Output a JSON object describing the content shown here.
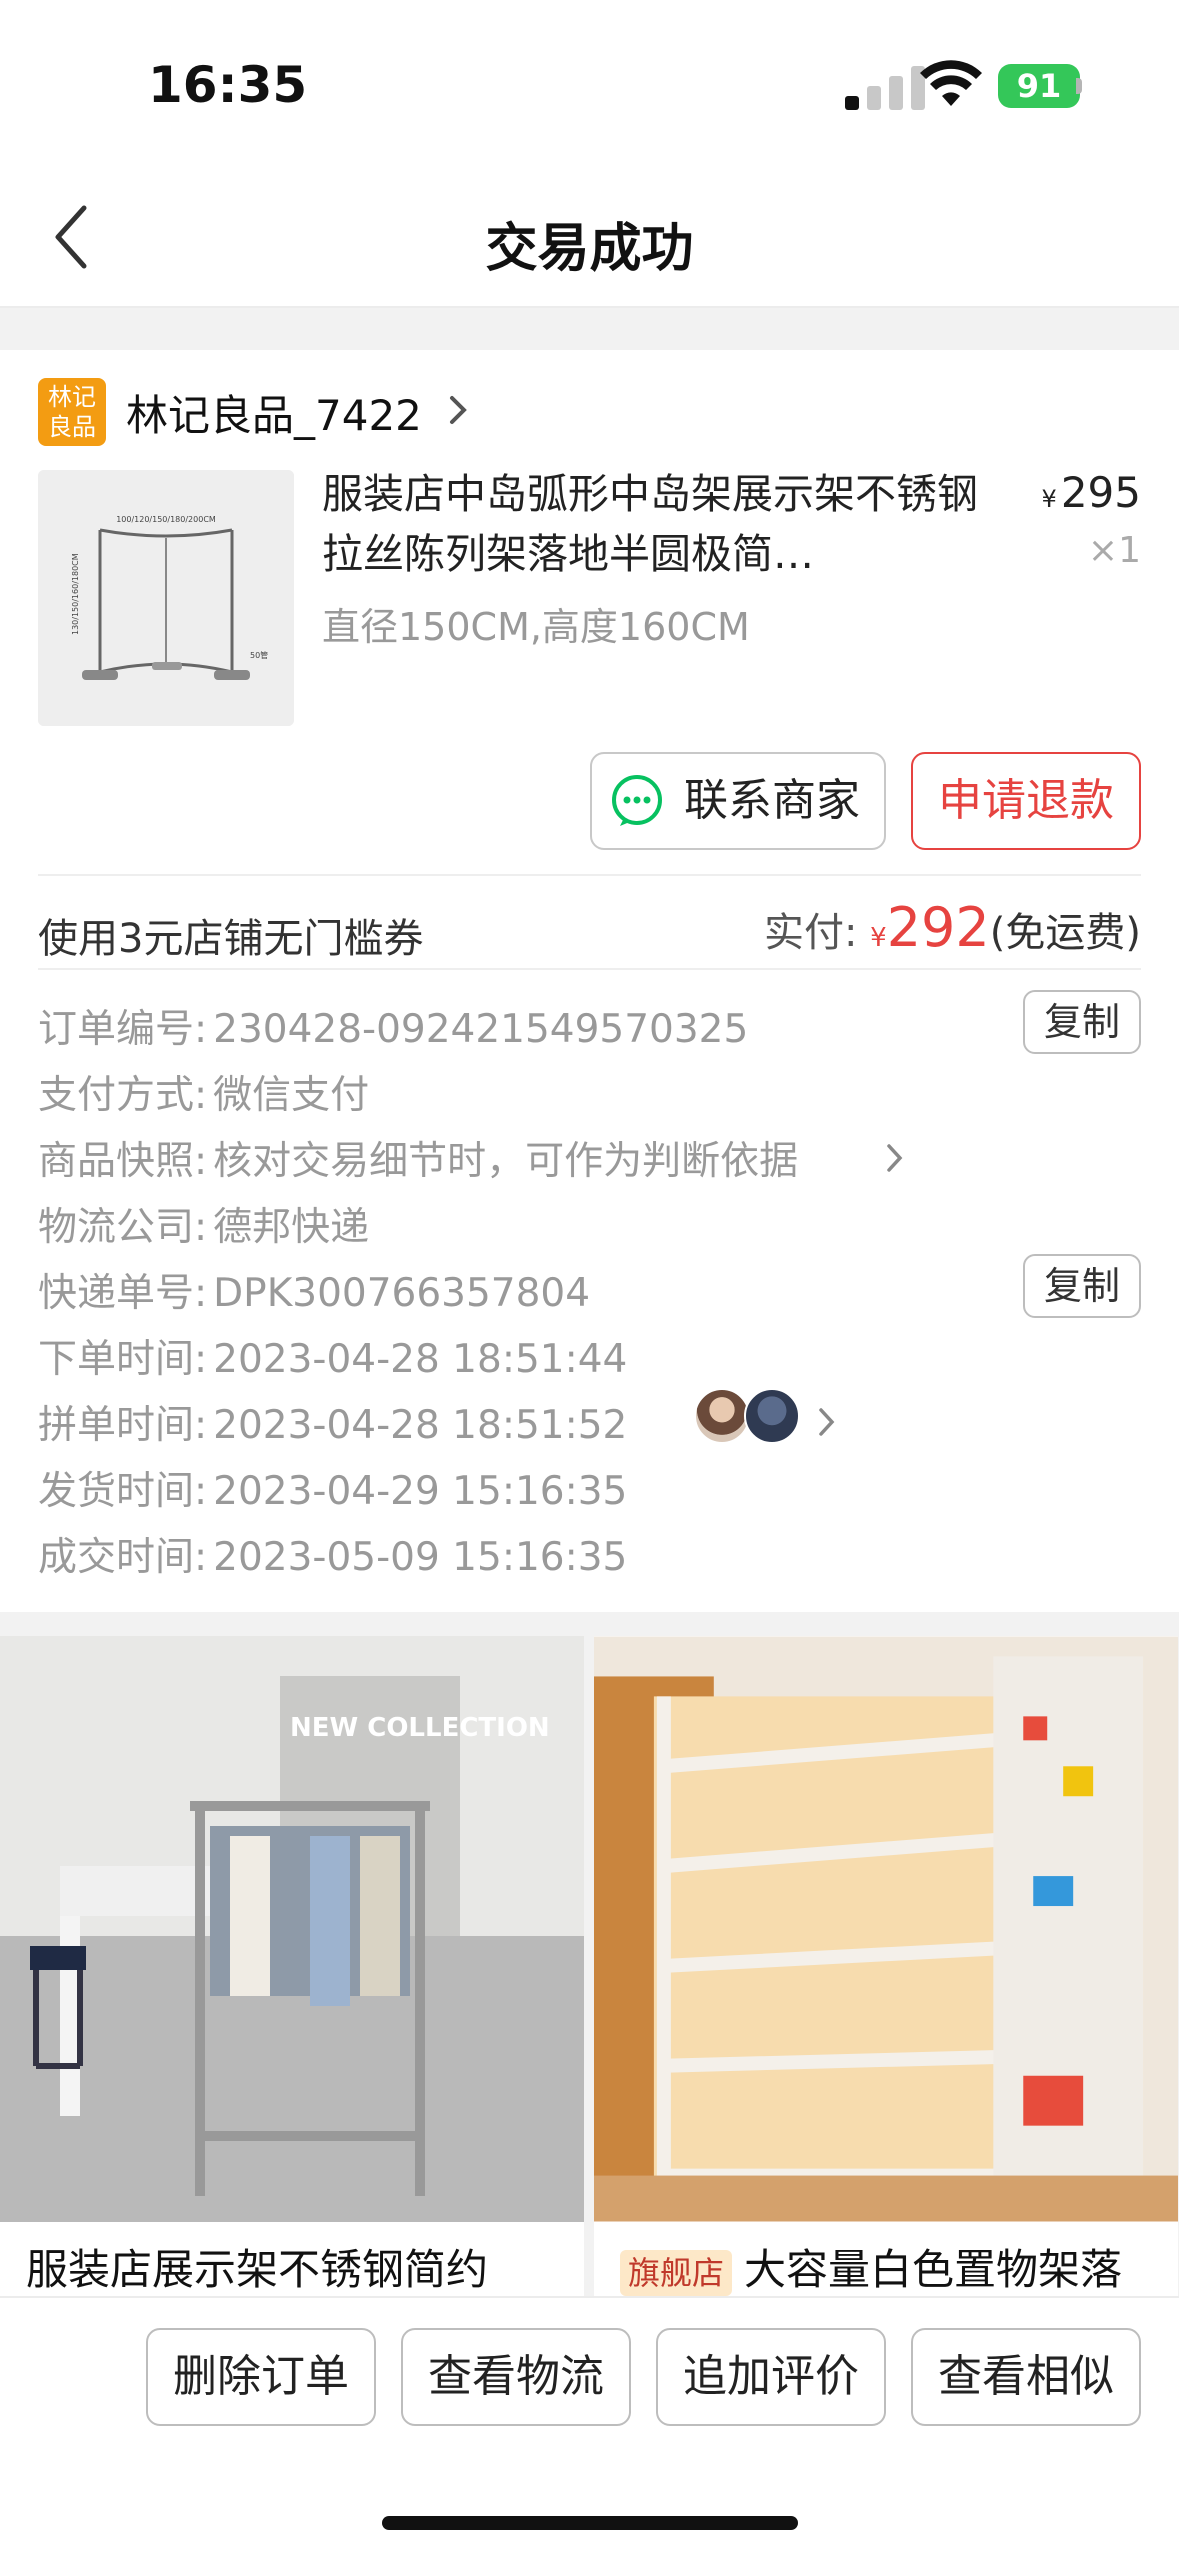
{
  "status": {
    "time": "16:35",
    "battery": "91"
  },
  "nav": {
    "title": "交易成功"
  },
  "shop": {
    "logo_line1": "林记",
    "logo_line2": "良品",
    "name": "林记良品_7422"
  },
  "product": {
    "title": "服装店中岛弧形中岛架展示架不锈钢拉丝陈列架落地半圆极简…",
    "spec": "直径150CM,高度160CM",
    "currency": "¥",
    "price": "295",
    "qty": "×1",
    "diagram_label_top": "100/120/150/180/200CM",
    "diagram_label_side": "130/150/160/180CM",
    "diagram_label_foot": "50管"
  },
  "actions": {
    "contact": "联系商家",
    "refund": "申请退款"
  },
  "payment": {
    "coupon": "使用3元店铺无门槛券",
    "paid_label": "实付:",
    "currency": "¥",
    "paid_amount": "292",
    "shipping": "(免运费)"
  },
  "order_info": [
    {
      "label": "订单编号:",
      "value": "230428-092421549570325"
    },
    {
      "label": "支付方式:",
      "value": "微信支付"
    },
    {
      "label": "商品快照:",
      "value": "核对交易细节时，可作为判断依据"
    },
    {
      "label": "物流公司:",
      "value": "德邦快递"
    },
    {
      "label": "快递单号:",
      "value": "DPK300766357804"
    },
    {
      "label": "下单时间:",
      "value": "2023-04-28 18:51:44"
    },
    {
      "label": "拼单时间:",
      "value": "2023-04-28 18:51:52"
    },
    {
      "label": "发货时间:",
      "value": "2023-04-29 15:16:35"
    },
    {
      "label": "成交时间:",
      "value": "2023-05-09 15:16:35"
    }
  ],
  "copy_label": "复制",
  "recommend": [
    {
      "title": "服装店展示架不锈钢简约",
      "image_text": "NEW COLLECTION"
    },
    {
      "badge": "旗舰店",
      "title": "大容量白色置物架落"
    }
  ],
  "bottom": {
    "delete": "删除订单",
    "logistics": "查看物流",
    "review": "追加评价",
    "similar": "查看相似"
  },
  "colors": {
    "accent_red": "#e64340",
    "shop_orange": "#f39c12",
    "wechat_green": "#07c160",
    "battery_green": "#34c759"
  }
}
